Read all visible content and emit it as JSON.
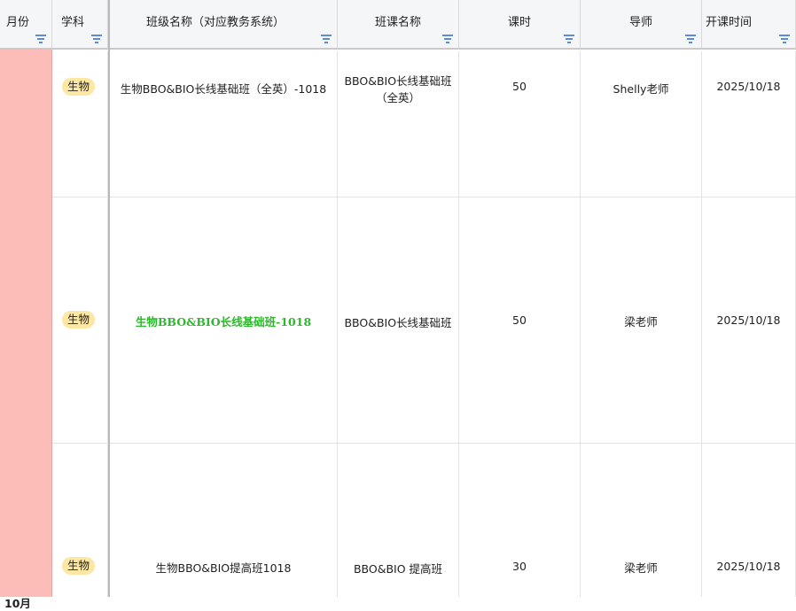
{
  "header": {
    "month": "月份",
    "subject": "学科",
    "class_name": "班级名称（对应教务系统）",
    "course_name": "班课名称",
    "hours": "课时",
    "teacher": "导师",
    "start_date": "开课时间"
  },
  "month_value": "10月",
  "rows": [
    {
      "subject": "生物",
      "class_name": "生物BBO&BIO长线基础班（全英）-1018",
      "course_name_line1": "BBO&BIO长线基础班",
      "course_name_line2": "（全英）",
      "hours": "50",
      "teacher": "Shelly老师",
      "start_date": "2025/10/18"
    },
    {
      "subject": "生物",
      "class_name": "生物BBO&BIO长线基础班-1018",
      "course_name": "BBO&BIO长线基础班",
      "hours": "50",
      "teacher": "梁老师",
      "start_date": "2025/10/18"
    },
    {
      "subject": "生物",
      "class_name": "生物BBO&BIO提高班1018",
      "course_name": "BBO&BIO 提高班",
      "hours": "30",
      "teacher": "梁老师",
      "start_date": "2025/10/18"
    }
  ],
  "colors": {
    "month_fill": "#fcbcb8",
    "subject_tag": "#fde7a4",
    "highlight_text": "#2bb82b",
    "filter_icon": "#5b8cdb"
  },
  "icons": {
    "column_filter": "filter-icon"
  }
}
